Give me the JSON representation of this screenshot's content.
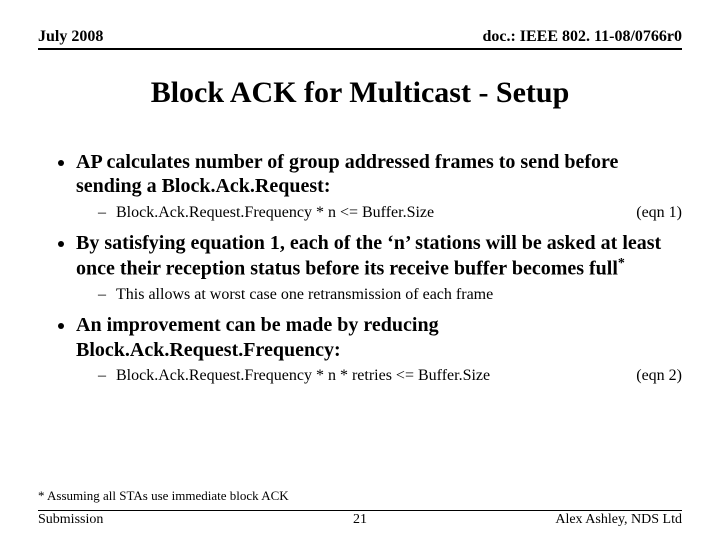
{
  "header": {
    "left": "July 2008",
    "right": "doc.: IEEE 802. 11-08/0766r0"
  },
  "title": "Block ACK for Multicast - Setup",
  "bullets": {
    "b1": "AP calculates number of group addressed frames to send before sending a Block.Ack.Request:",
    "b1s": "Block.Ack.Request.Frequency * n <= Buffer.Size",
    "b1e": "(eqn 1)",
    "b2a": "By satisfying equation 1, each of the ‘n’ stations will be asked at least once their reception status before its receive buffer becomes full",
    "b2star": "*",
    "b2s": "This allows at worst case one retransmission of each frame",
    "b3": "An improvement can be made by reducing Block.Ack.Request.Frequency:",
    "b3s": "Block.Ack.Request.Frequency * n * retries <= Buffer.Size",
    "b3e": "(eqn 2)"
  },
  "footnote": "* Assuming all STAs use immediate block ACK",
  "footer": {
    "left": "Submission",
    "center": "21",
    "right": "Alex Ashley, NDS Ltd"
  }
}
